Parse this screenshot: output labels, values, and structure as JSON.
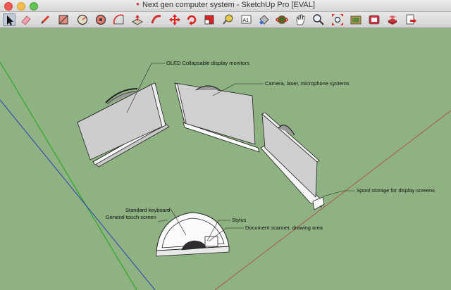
{
  "window": {
    "title": "Next gen computer system - SketchUp Pro [EVAL]"
  },
  "toolbar": {
    "tools": [
      {
        "name": "select-tool-icon"
      },
      {
        "name": "eraser-tool-icon"
      },
      {
        "name": "pencil-tool-icon"
      },
      {
        "name": "rectangle-tool-icon"
      },
      {
        "name": "circle-tool-icon"
      },
      {
        "name": "polygon-tool-icon"
      },
      {
        "name": "arc-tool-icon"
      },
      {
        "name": "push-pull-tool-icon"
      },
      {
        "name": "follow-me-tool-icon"
      },
      {
        "name": "move-tool-icon"
      },
      {
        "name": "rotate-tool-icon"
      },
      {
        "name": "scale-tool-icon"
      },
      {
        "name": "tape-measure-tool-icon"
      },
      {
        "name": "text-tool-icon"
      },
      {
        "name": "paint-bucket-tool-icon"
      },
      {
        "name": "orbit-tool-icon"
      },
      {
        "name": "pan-tool-icon"
      },
      {
        "name": "zoom-tool-icon"
      },
      {
        "name": "zoom-extents-tool-icon"
      },
      {
        "name": "warehouse-tool-icon"
      },
      {
        "name": "extension-warehouse-tool-icon"
      },
      {
        "name": "components-tool-icon"
      },
      {
        "name": "layout-send-tool-icon"
      }
    ],
    "selected_tool": "select-tool-icon",
    "text_tool_glyph": "A1"
  },
  "canvas": {
    "background": "#8fb283",
    "axis_colors": {
      "red": "#b5423a",
      "green": "#19a81c",
      "blue": "#2b3fb5"
    }
  },
  "annotations": {
    "oled_monitors": "OLED Collapsable display monitors",
    "camera_systems": "Camera, laser, microphone systems",
    "spool_storage": "Spool storage for display screens",
    "standard_keyboard": "Standard keyboard",
    "general_touch_screen": "General touch screen",
    "stylus": "Stylus",
    "document_scanner": "Document scanner, drawing area"
  }
}
